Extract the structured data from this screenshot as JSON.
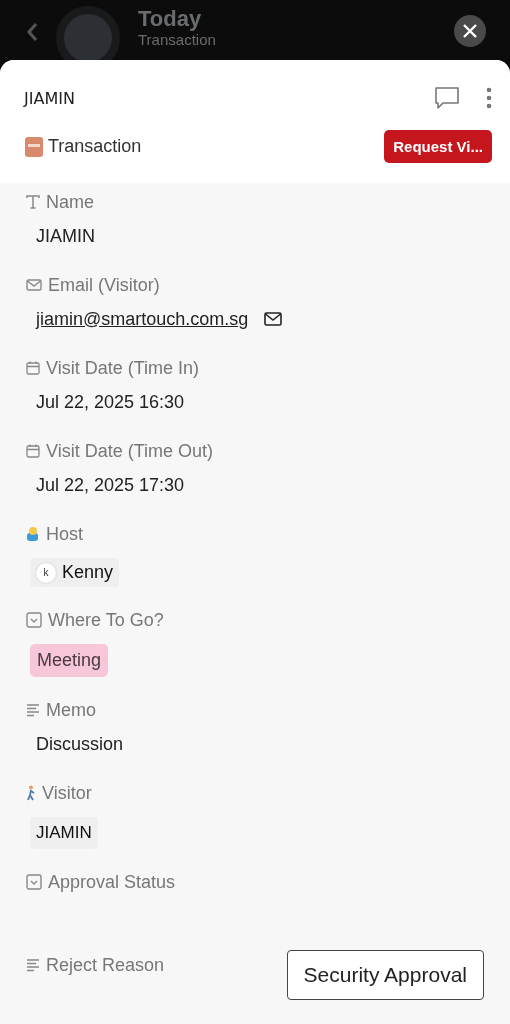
{
  "backdrop": {
    "title": "Today",
    "subtitle": "Transaction"
  },
  "sheet": {
    "title": "JIAMIN",
    "database": "Transaction",
    "action_button": "Request Vi..."
  },
  "properties": [
    {
      "kind": "text",
      "label": "Name",
      "value": "JIAMIN"
    },
    {
      "kind": "email",
      "label": "Email (Visitor)",
      "value": "jiamin@smartouch.com.sg"
    },
    {
      "kind": "date",
      "label": "Visit Date (Time In)",
      "value": "Jul 22, 2025 16:30"
    },
    {
      "kind": "date",
      "label": "Visit Date (Time Out)",
      "value": "Jul 22, 2025 17:30"
    },
    {
      "kind": "person",
      "label": "Host",
      "value": "Kenny",
      "avatar_letter": "k"
    },
    {
      "kind": "select",
      "label": "Where To Go?",
      "value": "Meeting",
      "color": "#f7c6d9"
    },
    {
      "kind": "memo",
      "label": "Memo",
      "value": "Discussion"
    },
    {
      "kind": "relation",
      "label": "Visitor",
      "value": "JIAMIN"
    },
    {
      "kind": "select",
      "label": "Approval Status"
    },
    {
      "kind": "memo",
      "label": "Reject Reason"
    }
  ],
  "floating_button": "Security Approval"
}
